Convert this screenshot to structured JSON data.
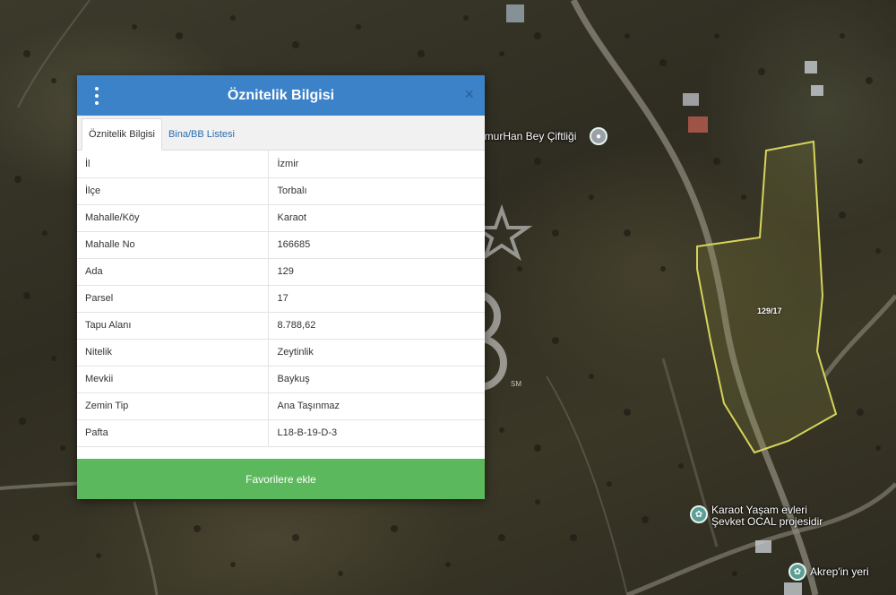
{
  "map": {
    "parcel_label": "129/17",
    "places": [
      {
        "label": "imurHan Bey Çiftliği"
      },
      {
        "label": "Karaot Yaşam evleri\nŞevket OCAL projesidir"
      },
      {
        "label": "Akrep'in yeri"
      }
    ],
    "parcel_outline_color": "#d6d45a"
  },
  "watermark": {
    "sm": "SM"
  },
  "panel": {
    "title": "Öznitelik Bilgisi",
    "close": "×",
    "tabs": [
      {
        "label": "Öznitelik Bilgisi",
        "active": true
      },
      {
        "label": "Bina/BB Listesi",
        "active": false
      }
    ],
    "rows": [
      {
        "key": "İl",
        "value": "İzmir"
      },
      {
        "key": "İlçe",
        "value": "Torbalı"
      },
      {
        "key": "Mahalle/Köy",
        "value": "Karaot"
      },
      {
        "key": "Mahalle No",
        "value": "166685"
      },
      {
        "key": "Ada",
        "value": "129"
      },
      {
        "key": "Parsel",
        "value": "17"
      },
      {
        "key": "Tapu Alanı",
        "value": "8.788,62"
      },
      {
        "key": "Nitelik",
        "value": "Zeytinlik"
      },
      {
        "key": "Mevkii",
        "value": "Baykuş"
      },
      {
        "key": "Zemin Tip",
        "value": "Ana Taşınmaz"
      },
      {
        "key": "Pafta",
        "value": "L18-B-19-D-3"
      }
    ],
    "favorite_button": "Favorilere ekle",
    "colors": {
      "header": "#3b82c9",
      "button": "#5cb85c"
    }
  }
}
